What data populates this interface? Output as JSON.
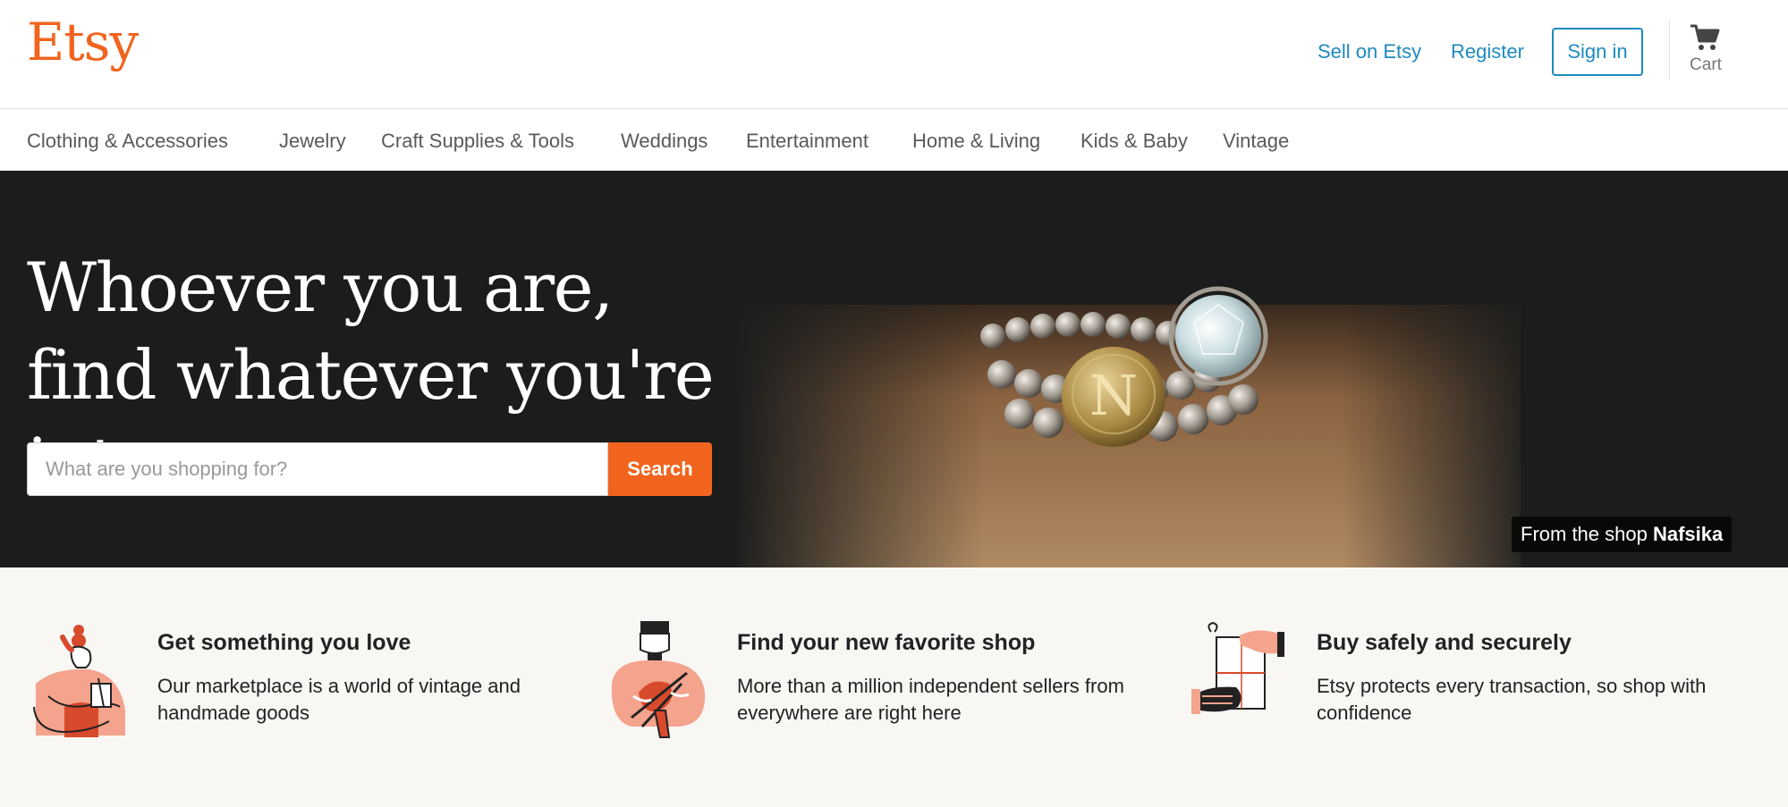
{
  "header": {
    "logo": "Etsy",
    "sell_link": "Sell on Etsy",
    "register_link": "Register",
    "signin_button": "Sign in",
    "cart_label": "Cart",
    "cart_icon": "cart-icon"
  },
  "categories": [
    "Clothing & Accessories",
    "Jewelry",
    "Craft Supplies & Tools",
    "Weddings",
    "Entertainment",
    "Home & Living",
    "Kids & Baby",
    "Vintage"
  ],
  "hero": {
    "headline": "Whoever you are, find whatever you're into",
    "search_placeholder": "What are you shopping for?",
    "search_button": "Search",
    "credit_prefix": "From the shop",
    "credit_shop": "Nafsika"
  },
  "value_props": [
    {
      "title": "Get something you love",
      "body": "Our marketplace is a world of vintage and handmade goods",
      "icon": "person-holding-item-icon"
    },
    {
      "title": "Find your new favorite shop",
      "body": "More than a million independent sellers from everywhere are right here",
      "icon": "person-knitting-icon"
    },
    {
      "title": "Buy safely and securely",
      "body": "Etsy protects every transaction, so shop with confidence",
      "icon": "hands-exchange-icon"
    }
  ],
  "colors": {
    "brand_orange": "#f1641e",
    "link_blue": "#1d8abf",
    "hero_bg": "#1b1d1d",
    "props_bg": "#f8f7f4"
  }
}
